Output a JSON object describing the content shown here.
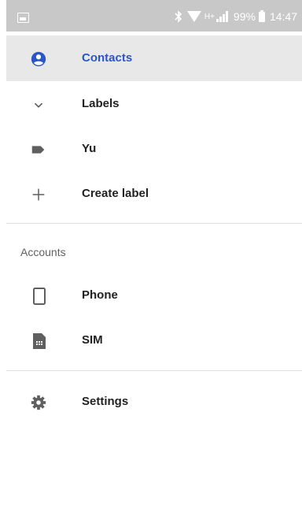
{
  "status_bar": {
    "network_type": "H+",
    "battery_percent": "99%",
    "time": "14:47"
  },
  "drawer": {
    "items": [
      {
        "label": "Contacts",
        "icon": "account-circle-icon",
        "selected": true
      },
      {
        "label": "Labels",
        "icon": "chevron-down-icon"
      },
      {
        "label": "Yu",
        "icon": "label-tag-icon"
      },
      {
        "label": "Create label",
        "icon": "plus-icon"
      }
    ],
    "accounts_header": "Accounts",
    "accounts": [
      {
        "label": "Phone",
        "icon": "phone-icon"
      },
      {
        "label": "SIM",
        "icon": "sim-card-icon"
      }
    ],
    "settings": {
      "label": "Settings",
      "icon": "gear-icon"
    }
  },
  "colors": {
    "accent": "#2a56c6",
    "selected_bg": "#e8e8e8",
    "status_bar_bg": "#c8c8c8",
    "icon_gray": "#5f5f5f"
  }
}
